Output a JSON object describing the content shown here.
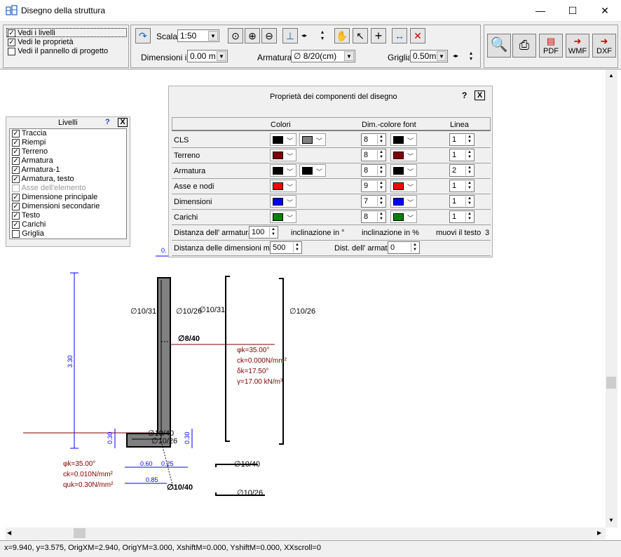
{
  "window": {
    "title": "Disegno della struttura",
    "minimize": "—",
    "maximize": "☐",
    "close": "✕"
  },
  "view_options": [
    {
      "label": "Vedi i livelli",
      "checked": true
    },
    {
      "label": "Vedi le proprietà",
      "checked": true
    },
    {
      "label": "Vedi il pannello di progetto",
      "checked": false
    }
  ],
  "toolbar": {
    "scale_label": "Scala",
    "scale_value": "1:50",
    "dimensions_label": "Dimensioni in",
    "dimensions_value": "0.00 m",
    "armatura_label": "Armatura",
    "armatura_value": "∅ 8/20(cm)",
    "griglia_label": "Griglia",
    "griglia_value": "0.50m",
    "pdf_label": "PDF",
    "wmf_label": "WMF",
    "dxf_label": "DXF"
  },
  "levels_panel": {
    "title": "Livelli",
    "help": "?",
    "close": "X",
    "items": [
      {
        "label": "Traccia",
        "checked": true
      },
      {
        "label": "Riempi",
        "checked": true
      },
      {
        "label": "Terreno",
        "checked": true
      },
      {
        "label": "Armatura",
        "checked": true
      },
      {
        "label": "Armatura-1",
        "checked": true
      },
      {
        "label": "Armatura, testo",
        "checked": true
      },
      {
        "label": "Asse dell'elemento",
        "checked": false,
        "disabled": true
      },
      {
        "label": "Dimensione principale",
        "checked": true
      },
      {
        "label": "Dimensioni secondarie",
        "checked": true
      },
      {
        "label": "Testo",
        "checked": true
      },
      {
        "label": "Carichi",
        "checked": true
      },
      {
        "label": "Griglia",
        "checked": false
      }
    ]
  },
  "props_panel": {
    "title": "Proprietà dei componenti del disegno",
    "help": "?",
    "close": "X",
    "headers": {
      "colori": "Colori",
      "font": "Dim.-colore font",
      "linea": "Linea"
    },
    "rows": [
      {
        "label": "CLS",
        "color1": "#000000",
        "color2": "#808080",
        "font_size": "8",
        "font_color": "#000000",
        "line": "1"
      },
      {
        "label": "Terreno",
        "color1": "#800000",
        "font_size": "8",
        "font_color": "#800000",
        "line": "1"
      },
      {
        "label": "Armatura",
        "color1": "#000000",
        "color2": "#000000",
        "font_size": "8",
        "font_color": "#000000",
        "line": "2"
      },
      {
        "label": "Asse e nodi",
        "color1": "#ff0000",
        "font_size": "9",
        "font_color": "#ff0000",
        "line": "1"
      },
      {
        "label": "Dimensioni",
        "color1": "#0000ff",
        "font_size": "7",
        "font_color": "#0000ff",
        "line": "1"
      },
      {
        "label": "Carichi",
        "color1": "#008000",
        "font_size": "8",
        "font_color": "#008000",
        "line": "1"
      }
    ],
    "dist_armatura_label": "Distanza dell' armatura",
    "dist_armatura_value": "100",
    "inclinazione_deg": "inclinazione in °",
    "inclinazione_pct": "inclinazione in %",
    "muovi_testo": "muovi il testo",
    "muovi_value": "3",
    "dist_dimensioni_label": "Distanza delle dimensioni mm",
    "dist_dimensioni_value": "500",
    "dist_armat_label": "Dist. dell' armat.",
    "dist_armat_value": "0"
  },
  "drawing": {
    "height_dim": "3.30",
    "base_dim_left": "0.30",
    "base_dim_right": "0.30",
    "dim_060": "0.60",
    "dim_025": "0.25",
    "dim_085": "0.85",
    "top_marker": "0.",
    "rebar_labels": {
      "r1": "∅10/31",
      "r2": "∅10/26",
      "r3": "∅10/31",
      "r4": "∅10/26",
      "r5": "∅8/40",
      "r6": "∅10/40",
      "r7": "∅10/26",
      "r8": "∅10/40",
      "r9": "∅10/40",
      "r10": "∅10/26"
    },
    "soil_right": [
      "φk=35.00°",
      "ck=0.000N/mm²",
      "δk=17.50°",
      "γ=17.00 kN/m³"
    ],
    "soil_left": [
      "φk=35.00°",
      "ck=0.010N/mm²",
      "quk=0.30N/mm²"
    ]
  },
  "status": "x=9.940, y=3.575, OrigXM=2.940,  OrigYM=3.000, XshiftM=0.000, YshiftM=0.000, XXscroll=0"
}
